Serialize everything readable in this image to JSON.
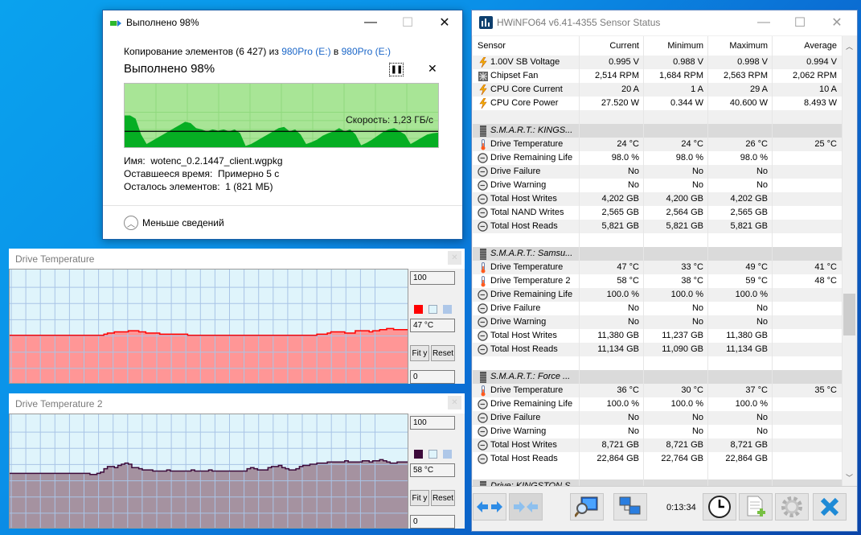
{
  "copy_dialog": {
    "title": "Выполнено 98%",
    "progress_percent": 98,
    "line1_prefix": "Копирование элементов (6 427) из ",
    "source": "980Pro (E:)",
    "line1_mid": " в ",
    "destination": "980Pro (E:)",
    "status": "Выполнено 98%",
    "speed_label": "Скорость: 1,23 ГБ/с",
    "name_label": "Имя:",
    "name_value": "wotenc_0.2.1447_client.wgpkg",
    "time_label": "Оставшееся время:",
    "time_value": "Примерно 5 с",
    "items_label": "Осталось элементов:",
    "items_value": "1 (821 МБ)",
    "less_details": "Меньше сведений",
    "colors": {
      "fill": "#06ae23",
      "background": "#a8e596",
      "grid": "#8fd97d"
    }
  },
  "graphs": [
    {
      "title": "Drive Temperature",
      "max_label": "100",
      "min_label": "0",
      "current": "47 °C",
      "fit_label": "Fit y",
      "reset_label": "Reset",
      "line_color": "#ff0000",
      "fill_color": "#ff9696",
      "swatches": [
        "#ff0000",
        "#dff4fb",
        "#aec7e8"
      ]
    },
    {
      "title": "Drive Temperature 2",
      "max_label": "100",
      "min_label": "0",
      "current": "58 °C",
      "fit_label": "Fit y",
      "reset_label": "Reset",
      "line_color": "#3d0a3a",
      "fill_color": "#a592a0",
      "swatches": [
        "#3d0a3a",
        "#dff4fb",
        "#aec7e8"
      ]
    }
  ],
  "chart_data": [
    {
      "type": "area",
      "title": "Скорость: 1,23 ГБ/с",
      "xlabel": "",
      "ylabel": "",
      "note": "copy throughput history, relative (0-1 of chart height), horizontal line = current speed",
      "ylim": [
        0,
        1
      ],
      "current_line": 0.75,
      "values": [
        0.5,
        0.5,
        0.55,
        0.8,
        0.95,
        0.9,
        0.85,
        0.8,
        0.75,
        0.7,
        0.65,
        0.6,
        0.62,
        0.7,
        0.72,
        0.75,
        0.72,
        0.74,
        0.72,
        0.75,
        0.72,
        0.78,
        0.98,
        0.95,
        0.9,
        0.85,
        0.8,
        0.75,
        0.7,
        0.68,
        0.75,
        0.72,
        0.8,
        0.95,
        0.92,
        0.88,
        0.82,
        0.78,
        0.75,
        0.7,
        0.75,
        0.72,
        0.8,
        0.97,
        0.93,
        0.88,
        0.82,
        0.76,
        0.72,
        0.7,
        0.75,
        0.8,
        0.95,
        0.9,
        0.85,
        0.8,
        0.78,
        0.77
      ]
    },
    {
      "type": "area",
      "title": "Drive Temperature",
      "ylim": [
        0,
        100
      ],
      "ylabel": "°C",
      "values": [
        42,
        42,
        42,
        42,
        42,
        42,
        42,
        42,
        42,
        42,
        42,
        42,
        42,
        42,
        42,
        42,
        42,
        42,
        42,
        42,
        42,
        42,
        42,
        42,
        42,
        42,
        42,
        43,
        44,
        44,
        45,
        45,
        45,
        45,
        46,
        46,
        46,
        45,
        45,
        44,
        44,
        44,
        44,
        43,
        43,
        43,
        43,
        43,
        43,
        43,
        43,
        42,
        42,
        42,
        42,
        42,
        42,
        42,
        42,
        42,
        42,
        42,
        42,
        42,
        42,
        42,
        42,
        42,
        42,
        42,
        42,
        42,
        42,
        42,
        42,
        42,
        42,
        42,
        42,
        42,
        42,
        42,
        42,
        42,
        42,
        42,
        42,
        42,
        43,
        43,
        43,
        44,
        45,
        45,
        45,
        45,
        44,
        44,
        44,
        46,
        46,
        46,
        46,
        45,
        46,
        46,
        47,
        47,
        48,
        48,
        47,
        47,
        47,
        47
      ]
    },
    {
      "type": "area",
      "title": "Drive Temperature 2",
      "ylim": [
        0,
        100
      ],
      "ylabel": "°C",
      "values": [
        48,
        48,
        48,
        48,
        48,
        48,
        48,
        48,
        48,
        48,
        48,
        48,
        48,
        48,
        48,
        48,
        48,
        48,
        48,
        48,
        48,
        48,
        48,
        47,
        47,
        48,
        49,
        52,
        54,
        54,
        53,
        55,
        56,
        57,
        56,
        53,
        53,
        52,
        51,
        51,
        51,
        50,
        50,
        50,
        50,
        51,
        50,
        50,
        50,
        50,
        50,
        50,
        51,
        50,
        50,
        50,
        50,
        51,
        50,
        50,
        50,
        50,
        50,
        50,
        50,
        50,
        50,
        50,
        52,
        53,
        52,
        51,
        51,
        51,
        53,
        54,
        54,
        55,
        53,
        52,
        51,
        51,
        52,
        54,
        55,
        55,
        56,
        56,
        57,
        57,
        57,
        58,
        58,
        58,
        58,
        58,
        59,
        58,
        58,
        58,
        58,
        59,
        59,
        58,
        59,
        59,
        60,
        59,
        58,
        57,
        57,
        58,
        58,
        58
      ]
    }
  ],
  "hwinfo": {
    "title": "HWiNFO64 v6.41-4355 Sensor Status",
    "columns": [
      "Sensor",
      "Current",
      "Minimum",
      "Maximum",
      "Average"
    ],
    "rows": [
      {
        "type": "sensor",
        "icon": "bolt",
        "name": "1.00V SB Voltage",
        "cur": "0.995 V",
        "min": "0.988 V",
        "max": "0.998 V",
        "avg": "0.994 V"
      },
      {
        "type": "sensor",
        "icon": "fan",
        "name": "Chipset Fan",
        "cur": "2,514 RPM",
        "min": "1,684 RPM",
        "max": "2,563 RPM",
        "avg": "2,062 RPM"
      },
      {
        "type": "sensor",
        "icon": "bolt",
        "name": "CPU Core Current",
        "cur": "20 A",
        "min": "1 A",
        "max": "29 A",
        "avg": "10 A"
      },
      {
        "type": "sensor",
        "icon": "bolt",
        "name": "CPU Core Power",
        "cur": "27.520 W",
        "min": "0.344 W",
        "max": "40.600 W",
        "avg": "8.493 W"
      },
      {
        "type": "blank"
      },
      {
        "type": "group",
        "name": "S.M.A.R.T.: KINGS..."
      },
      {
        "type": "sensor",
        "icon": "thermo",
        "name": "Drive Temperature",
        "cur": "24 °C",
        "min": "24 °C",
        "max": "26 °C",
        "avg": "25 °C"
      },
      {
        "type": "sensor",
        "icon": "clock",
        "name": "Drive Remaining Life",
        "cur": "98.0 %",
        "min": "98.0 %",
        "max": "98.0 %",
        "avg": ""
      },
      {
        "type": "sensor",
        "icon": "clock",
        "name": "Drive Failure",
        "cur": "No",
        "min": "No",
        "max": "No",
        "avg": ""
      },
      {
        "type": "sensor",
        "icon": "clock",
        "name": "Drive Warning",
        "cur": "No",
        "min": "No",
        "max": "No",
        "avg": ""
      },
      {
        "type": "sensor",
        "icon": "clock",
        "name": "Total Host Writes",
        "cur": "4,202 GB",
        "min": "4,200 GB",
        "max": "4,202 GB",
        "avg": ""
      },
      {
        "type": "sensor",
        "icon": "clock",
        "name": "Total NAND Writes",
        "cur": "2,565 GB",
        "min": "2,564 GB",
        "max": "2,565 GB",
        "avg": ""
      },
      {
        "type": "sensor",
        "icon": "clock",
        "name": "Total Host Reads",
        "cur": "5,821 GB",
        "min": "5,821 GB",
        "max": "5,821 GB",
        "avg": ""
      },
      {
        "type": "blank"
      },
      {
        "type": "group",
        "name": "S.M.A.R.T.: Samsu..."
      },
      {
        "type": "sensor",
        "icon": "thermo",
        "name": "Drive Temperature",
        "cur": "47 °C",
        "min": "33 °C",
        "max": "49 °C",
        "avg": "41 °C"
      },
      {
        "type": "sensor",
        "icon": "thermo",
        "name": "Drive Temperature 2",
        "cur": "58 °C",
        "min": "38 °C",
        "max": "59 °C",
        "avg": "48 °C"
      },
      {
        "type": "sensor",
        "icon": "clock",
        "name": "Drive Remaining Life",
        "cur": "100.0 %",
        "min": "100.0 %",
        "max": "100.0 %",
        "avg": ""
      },
      {
        "type": "sensor",
        "icon": "clock",
        "name": "Drive Failure",
        "cur": "No",
        "min": "No",
        "max": "No",
        "avg": ""
      },
      {
        "type": "sensor",
        "icon": "clock",
        "name": "Drive Warning",
        "cur": "No",
        "min": "No",
        "max": "No",
        "avg": ""
      },
      {
        "type": "sensor",
        "icon": "clock",
        "name": "Total Host Writes",
        "cur": "11,380 GB",
        "min": "11,237 GB",
        "max": "11,380 GB",
        "avg": ""
      },
      {
        "type": "sensor",
        "icon": "clock",
        "name": "Total Host Reads",
        "cur": "11,134 GB",
        "min": "11,090 GB",
        "max": "11,134 GB",
        "avg": ""
      },
      {
        "type": "blank"
      },
      {
        "type": "group",
        "name": "S.M.A.R.T.: Force ..."
      },
      {
        "type": "sensor",
        "icon": "thermo",
        "name": "Drive Temperature",
        "cur": "36 °C",
        "min": "30 °C",
        "max": "37 °C",
        "avg": "35 °C"
      },
      {
        "type": "sensor",
        "icon": "clock",
        "name": "Drive Remaining Life",
        "cur": "100.0 %",
        "min": "100.0 %",
        "max": "100.0 %",
        "avg": ""
      },
      {
        "type": "sensor",
        "icon": "clock",
        "name": "Drive Failure",
        "cur": "No",
        "min": "No",
        "max": "No",
        "avg": ""
      },
      {
        "type": "sensor",
        "icon": "clock",
        "name": "Drive Warning",
        "cur": "No",
        "min": "No",
        "max": "No",
        "avg": ""
      },
      {
        "type": "sensor",
        "icon": "clock",
        "name": "Total Host Writes",
        "cur": "8,721 GB",
        "min": "8,721 GB",
        "max": "8,721 GB",
        "avg": ""
      },
      {
        "type": "sensor",
        "icon": "clock",
        "name": "Total Host Reads",
        "cur": "22,864 GB",
        "min": "22,764 GB",
        "max": "22,864 GB",
        "avg": ""
      },
      {
        "type": "blank"
      },
      {
        "type": "group",
        "name": "Drive: KINGSTON S..."
      }
    ],
    "timer": "0:13:34",
    "toolbar_icons": [
      "expand-arrows-icon",
      "collapse-arrows-icon",
      "monitor-search-icon",
      "network-icon",
      "clock-icon",
      "add-report-icon",
      "settings-gear-icon",
      "close-x-icon"
    ]
  }
}
